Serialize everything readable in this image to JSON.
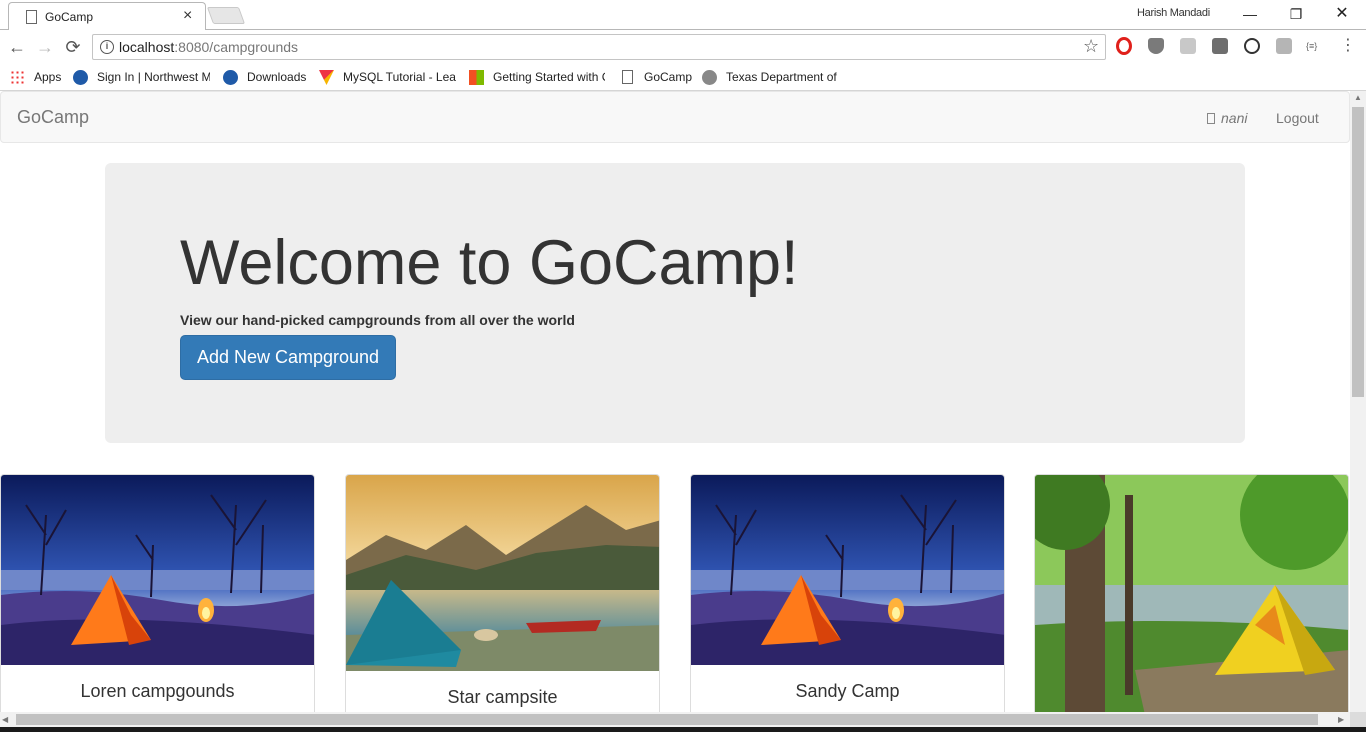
{
  "browser": {
    "tab_title": "GoCamp",
    "user_name": "Harish Mandadi",
    "url_host": "localhost",
    "url_path": ":8080/campgrounds",
    "window_controls": {
      "minimize": "—",
      "restore": "❐",
      "close": "✕"
    },
    "tab_close": "×",
    "nav": {
      "back": "←",
      "forward": "→",
      "reload": "⟳",
      "star": "☆",
      "menu": "⋮"
    },
    "extensions": {
      "json_label": "{≡}"
    },
    "bookmarks": [
      {
        "label": "Apps"
      },
      {
        "label": "Sign In | Northwest M"
      },
      {
        "label": "Downloads"
      },
      {
        "label": "MySQL Tutorial - Lea"
      },
      {
        "label": "Getting Started with C"
      },
      {
        "label": "GoCamp"
      },
      {
        "label": "Texas Department of"
      }
    ]
  },
  "navbar": {
    "brand": "GoCamp",
    "user": "nani",
    "logout": "Logout"
  },
  "jumbotron": {
    "title": "Welcome to GoCamp!",
    "subtitle": "View our hand-picked campgrounds from all over the world",
    "button": "Add New Campground"
  },
  "campgrounds": [
    {
      "name": "Loren campgounds",
      "image": "night-tent-campfire"
    },
    {
      "name": "Star campsite",
      "image": "lake-mountain-tent"
    },
    {
      "name": "Sandy Camp",
      "image": "night-tent-campfire"
    },
    {
      "name": "",
      "image": "forest-yellow-tent"
    }
  ],
  "scroll": {
    "up": "▲",
    "left": "◀",
    "right": "▶"
  },
  "colors": {
    "primary": "#337ab7",
    "jumbotron": "#eeeeee",
    "navbar": "#f8f8f8"
  }
}
